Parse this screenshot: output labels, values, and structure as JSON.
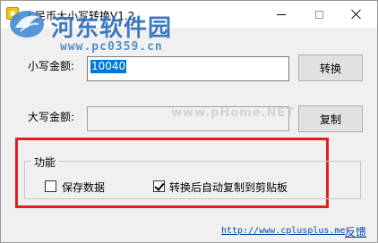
{
  "window": {
    "title": "人民币大小写转换V1.2"
  },
  "watermark": {
    "title": "河东软件园",
    "url": "www.pc0359.cn",
    "center_text": "www.pHome.NET"
  },
  "form": {
    "small_amount_label": "小写金额:",
    "small_amount_value": "10040",
    "big_amount_label": "大写金额:",
    "big_amount_value": "",
    "convert_button": "转换",
    "copy_button": "复制"
  },
  "options": {
    "group_title": "功能",
    "save_data_label": "保存数据",
    "save_data_checked": false,
    "auto_copy_label": "转换后自动复制到剪贴板",
    "auto_copy_checked": true
  },
  "footer": {
    "site_link": "http://www.cplusplus.me",
    "feedback_link": "反馈"
  },
  "colors": {
    "highlight_border": "#e21e1e",
    "selection": "#0078d7",
    "link": "#0645ad",
    "watermark": "#2d6fb8"
  }
}
